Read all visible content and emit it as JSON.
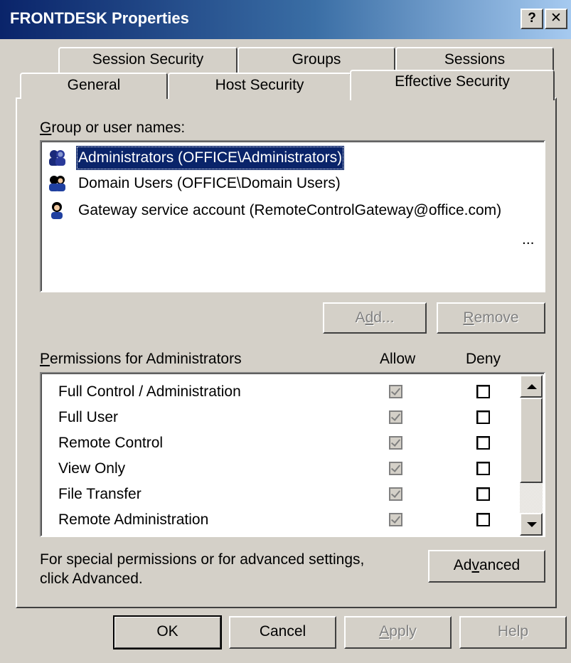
{
  "window": {
    "title": "FRONTDESK Properties",
    "help_button": "?",
    "close_button": "✕"
  },
  "tabs": {
    "back_row": [
      "Session Security",
      "Groups",
      "Sessions"
    ],
    "front_row": [
      "General",
      "Host Security",
      "Effective Security"
    ],
    "active": "Effective Security"
  },
  "users": {
    "label_prefix": "",
    "label_accel": "G",
    "label_rest": "roup or user names:",
    "items": [
      {
        "label": "Administrators (OFFICE\\Administrators)",
        "icon": "group-icon",
        "selected": true
      },
      {
        "label": "Domain Users (OFFICE\\Domain Users)",
        "icon": "group-icon",
        "selected": false
      },
      {
        "label": "Gateway service account (RemoteControlGateway@office.com)",
        "icon": "user-icon",
        "selected": false
      }
    ],
    "ellipsis": "..."
  },
  "buttons": {
    "add_pre": "A",
    "add_accel": "d",
    "add_post": "d...",
    "remove_accel": "R",
    "remove_rest": "emove",
    "advanced_pre": "Ad",
    "advanced_accel": "v",
    "advanced_post": "anced",
    "ok": "OK",
    "cancel": "Cancel",
    "apply_accel": "A",
    "apply_rest": "pply",
    "help": "Help"
  },
  "permissions": {
    "label_accel": "P",
    "label_rest": "ermissions for Administrators",
    "allow_header": "Allow",
    "deny_header": "Deny",
    "rows": [
      {
        "name": "Full Control / Administration",
        "allow": true,
        "deny": false
      },
      {
        "name": "Full User",
        "allow": true,
        "deny": false
      },
      {
        "name": "Remote Control",
        "allow": true,
        "deny": false
      },
      {
        "name": "View Only",
        "allow": true,
        "deny": false
      },
      {
        "name": "File Transfer",
        "allow": true,
        "deny": false
      },
      {
        "name": "Remote Administration",
        "allow": true,
        "deny": false
      }
    ]
  },
  "advanced_note": {
    "line1": "For special permissions or for advanced settings,",
    "line2": "click Advanced."
  },
  "colors": {
    "title_bar_start": "#0a246a",
    "title_bar_end": "#a6caf0",
    "face": "#d4d0c8",
    "selection": "#0a246a"
  }
}
